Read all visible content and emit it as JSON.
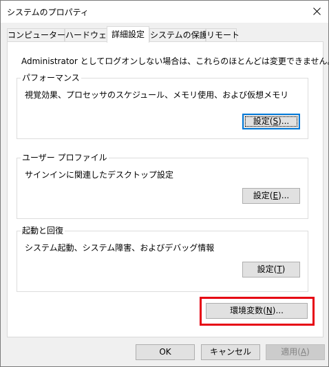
{
  "window": {
    "title": "システムのプロパティ",
    "close_icon": "close-icon"
  },
  "tabs": [
    {
      "label": "コンピューター名",
      "active": false
    },
    {
      "label": "ハードウェア",
      "active": false
    },
    {
      "label": "詳細設定",
      "active": true
    },
    {
      "label": "システムの保護",
      "active": false
    },
    {
      "label": "リモート",
      "active": false
    }
  ],
  "advanced": {
    "intro": "Administrator としてログオンしない場合は、これらのほとんどは変更できません。",
    "performance": {
      "title": "パフォーマンス",
      "description": "視覚効果、プロセッサのスケジュール、メモリ使用、および仮想メモリ",
      "button": {
        "text": "設定(",
        "mnemonic": "S",
        "suffix": ")..."
      }
    },
    "user_profile": {
      "title": "ユーザー プロファイル",
      "description": "サインインに関連したデスクトップ設定",
      "button": {
        "text": "設定(",
        "mnemonic": "E",
        "suffix": ")..."
      }
    },
    "startup_recovery": {
      "title": "起動と回復",
      "description": "システム起動、システム障害、およびデバッグ情報",
      "button": {
        "text": "設定(",
        "mnemonic": "T",
        "suffix": ")"
      }
    },
    "env_button": {
      "text": "環境変数(",
      "mnemonic": "N",
      "suffix": ")..."
    },
    "highlight_color": "#e60012"
  },
  "footer": {
    "ok": "OK",
    "cancel": "キャンセル",
    "apply": {
      "text": "適用(",
      "mnemonic": "A",
      "suffix": ")",
      "disabled": true
    }
  },
  "colors": {
    "focus_border": "#0078d7",
    "button_face": "#e1e1e1",
    "dialog_bg": "#f0f0f0"
  }
}
